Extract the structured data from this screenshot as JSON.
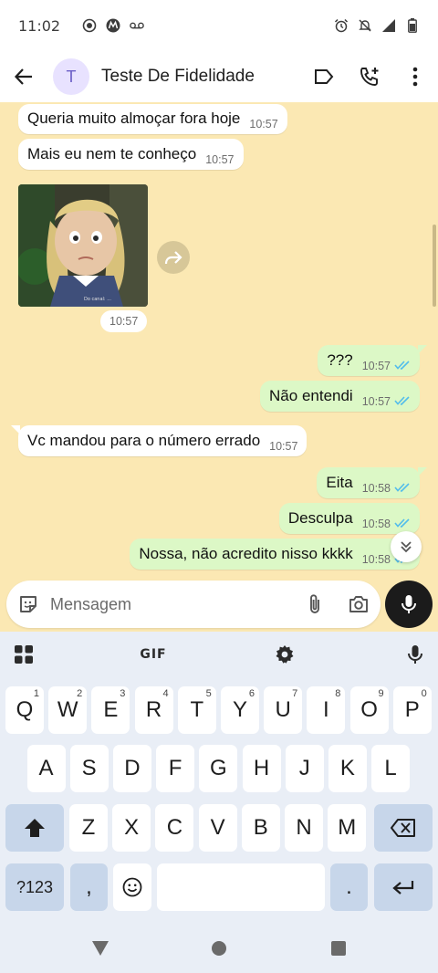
{
  "status_bar": {
    "time": "11:02",
    "left_icons": [
      "screen-record-icon",
      "motorola-icon",
      "voicemail-icon"
    ],
    "right_icons": [
      "alarm-icon",
      "bell-off-icon",
      "signal-icon",
      "battery-icon"
    ]
  },
  "header": {
    "avatar_letter": "T",
    "title": "Teste De Fidelidade",
    "icons": [
      "back-arrow-icon",
      "label-icon",
      "add-call-icon",
      "more-vert-icon"
    ]
  },
  "messages": [
    {
      "direction": "in",
      "text": "Queria muito almoçar fora hoje",
      "time": "10:57"
    },
    {
      "direction": "in",
      "text": "Mais eu nem te conheço",
      "time": "10:57"
    },
    {
      "direction": "in",
      "type": "image",
      "time": "10:57"
    },
    {
      "direction": "out",
      "text": "???",
      "time": "10:57",
      "read": true
    },
    {
      "direction": "out",
      "text": "Não entendi",
      "time": "10:57",
      "read": true
    },
    {
      "direction": "in",
      "text": "Vc mandou para o número errado",
      "time": "10:57"
    },
    {
      "direction": "out",
      "text": "Eita",
      "time": "10:58",
      "read": true
    },
    {
      "direction": "out",
      "text": "Desculpa",
      "time": "10:58",
      "read": true
    },
    {
      "direction": "out",
      "text": "Nossa, não acredito nisso kkkk",
      "time": "10:58",
      "read": true
    }
  ],
  "image_watermark": "Do canal: ...",
  "composer": {
    "placeholder": "Mensagem"
  },
  "keyboard": {
    "toolbar_gif": "GIF",
    "row1": [
      {
        "k": "Q",
        "h": "1"
      },
      {
        "k": "W",
        "h": "2"
      },
      {
        "k": "E",
        "h": "3"
      },
      {
        "k": "R",
        "h": "4"
      },
      {
        "k": "T",
        "h": "5"
      },
      {
        "k": "Y",
        "h": "6"
      },
      {
        "k": "U",
        "h": "7"
      },
      {
        "k": "I",
        "h": "8"
      },
      {
        "k": "O",
        "h": "9"
      },
      {
        "k": "P",
        "h": "0"
      }
    ],
    "row2": [
      "A",
      "S",
      "D",
      "F",
      "G",
      "H",
      "J",
      "K",
      "L"
    ],
    "row3": [
      "Z",
      "X",
      "C",
      "V",
      "B",
      "N",
      "M"
    ],
    "symbols_label": "?123",
    "comma": ",",
    "period": "."
  },
  "colors": {
    "chat_bg": "#fbe8b3",
    "outgoing_bubble": "#dcf8c6",
    "incoming_bubble": "#ffffff",
    "read_ticks": "#53bdeb",
    "keyboard_bg": "#e9eef6",
    "fn_key": "#c7d6ea"
  }
}
